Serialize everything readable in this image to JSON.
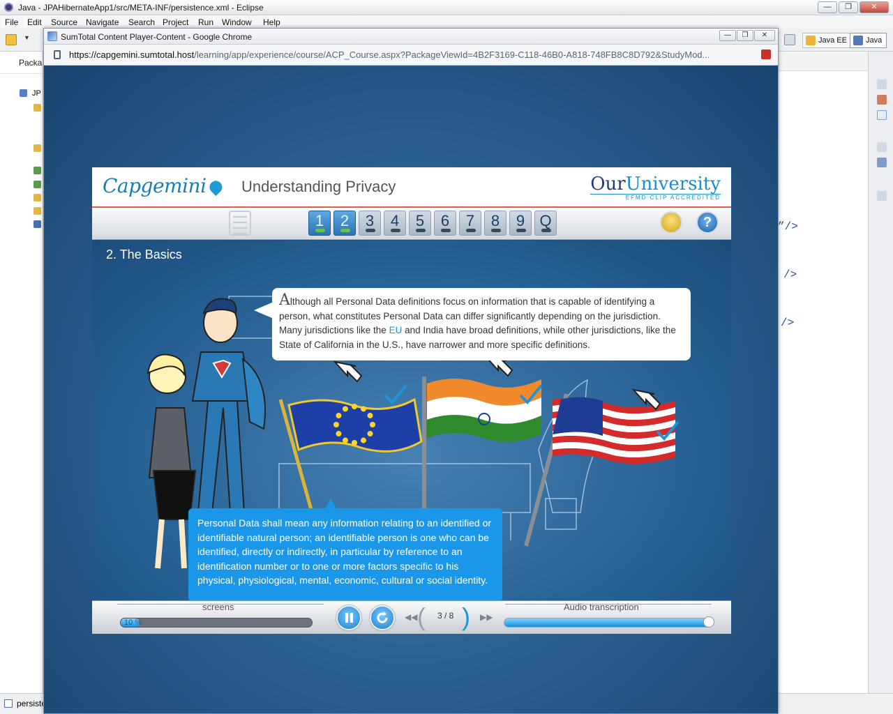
{
  "eclipse": {
    "title": "Java - JPAHibernateApp1/src/META-INF/persistence.xml - Eclipse",
    "menu": [
      "File",
      "Edit",
      "Source",
      "Navigate",
      "Search",
      "Project",
      "Run",
      "Window",
      "Help"
    ],
    "perspectives": [
      "Java EE",
      "Java"
    ],
    "left_panel_title": "Packa",
    "tree_label": "JP",
    "code_fragments": [
      "”/>",
      "/>",
      "/>"
    ],
    "status_tab": "persiste"
  },
  "chrome": {
    "title": "SumTotal Content Player-Content - Google Chrome",
    "url_host": "https://capgemini.sumtotal.host",
    "url_path": "/learning/app/experience/course/ACP_Course.aspx?PackageViewId=4B2F3169-C118-46B0-A818-748FB8C8D792&StudyMod..."
  },
  "player": {
    "logo": "Capgemini",
    "course_title": "Understanding Privacy",
    "brand": {
      "name_a": "Our",
      "name_b": "University",
      "tagline": "EFMD CLIP ACCREDITED"
    },
    "tabs": [
      {
        "label": "1",
        "done": true
      },
      {
        "label": "2",
        "done": true
      },
      {
        "label": "3",
        "done": false
      },
      {
        "label": "4",
        "done": false
      },
      {
        "label": "5",
        "done": false
      },
      {
        "label": "6",
        "done": false
      },
      {
        "label": "7",
        "done": false
      },
      {
        "label": "8",
        "done": false
      },
      {
        "label": "9",
        "done": false
      },
      {
        "label": "Q",
        "done": false
      }
    ],
    "slide_title": "2. The Basics",
    "bubble": {
      "cap": "A",
      "text_a": "lthough all Personal Data definitions focus on information that is capable of identifying a person,  what constitutes Personal Data can differ significantly depending on the jurisdiction. Many jurisdictions like the ",
      "eu": "EU",
      "text_b": " and India have broad definitions, while other jurisdictions, like the State of California in the U.S., have narrower and more specific definitions."
    },
    "info_text": "Personal Data shall mean any information relating to an identified or identifiable natural person; an identifiable person is one who can be identified, directly or indirectly, in particular by reference to an identification number or to one or more factors specific to his physical, physiological, mental, economic, cultural or social identity.",
    "controls": {
      "screens_label": "screens",
      "progress_pct": "10 %",
      "progress_value": 0.1,
      "page_indicator": "3 / 8",
      "audio_label": "Audio transcription",
      "audio_value": 0.98
    }
  },
  "colors": {
    "accent": "#1b96d8",
    "banner_rule": "#e35c49",
    "info_bg": "#1b97ea"
  }
}
